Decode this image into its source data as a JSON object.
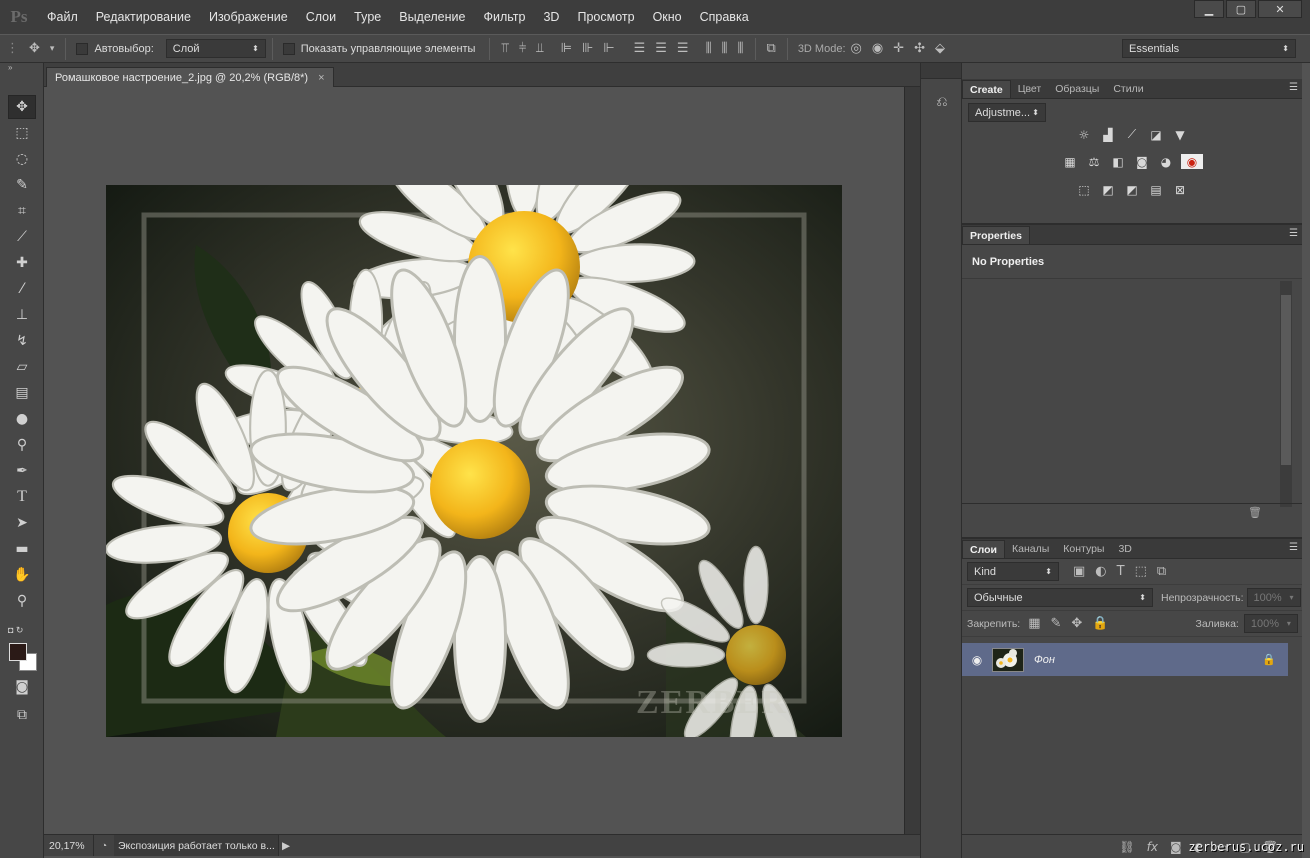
{
  "app": {
    "logo": "Ps"
  },
  "menu": [
    "Файл",
    "Редактирование",
    "Изображение",
    "Слои",
    "Type",
    "Выделение",
    "Фильтр",
    "3D",
    "Просмотр",
    "Окно",
    "Справка"
  ],
  "window_controls": {
    "minimize": "▁",
    "maximize": "▢",
    "close": "✕"
  },
  "options": {
    "autoselect_label": "Автовыбор:",
    "autoselect_value": "Слой",
    "show_controls_label": "Показать управляющие элементы",
    "mode_3d_label": "3D Mode:",
    "workspace": "Essentials"
  },
  "document": {
    "tab_title": "Ромашковое настроение_2.jpg @ 20,2% (RGB/8*)",
    "close": "×",
    "photo_watermark": "ZERBER"
  },
  "status": {
    "zoom": "20,17%",
    "message": "Экспозиция работает только в..."
  },
  "adjustments_panel": {
    "tabs": [
      "Create",
      "Цвет",
      "Образцы",
      "Стили"
    ],
    "active_tab": "Create",
    "select": "Adjustme...",
    "rows": [
      [
        "brightness-contrast-icon",
        "levels-icon",
        "curves-icon",
        "exposure-icon",
        "vibrance-icon"
      ],
      [
        "hue-saturation-icon",
        "color-balance-icon",
        "black-white-icon",
        "photo-filter-icon",
        "channel-mixer-icon",
        "color-lookup-icon"
      ],
      [
        "invert-icon",
        "posterize-icon",
        "threshold-icon",
        "gradient-map-icon",
        "selective-color-icon"
      ]
    ],
    "row_glyphs": [
      [
        "☼",
        "▟",
        "⟋",
        "◪",
        "▼"
      ],
      [
        "▦",
        "⚖",
        "◧",
        "◙",
        "◕",
        "◉"
      ],
      [
        "⬚",
        "◩",
        "◩",
        "▤",
        "⊠"
      ]
    ]
  },
  "properties_panel": {
    "tab": "Properties",
    "empty_text": "No Properties"
  },
  "layers_panel": {
    "tabs": [
      "Слои",
      "Каналы",
      "Контуры",
      "3D"
    ],
    "active_tab": "Слои",
    "filter_kind": "Kind",
    "blend_mode": "Обычные",
    "opacity_label": "Непрозрачность:",
    "opacity_value": "100%",
    "lock_label": "Закрепить:",
    "fill_label": "Заливка:",
    "fill_value": "100%",
    "layers": [
      {
        "name": "Фон",
        "visible": true,
        "locked": true
      }
    ]
  },
  "site_watermark": "zerberus.ucoz.ru"
}
